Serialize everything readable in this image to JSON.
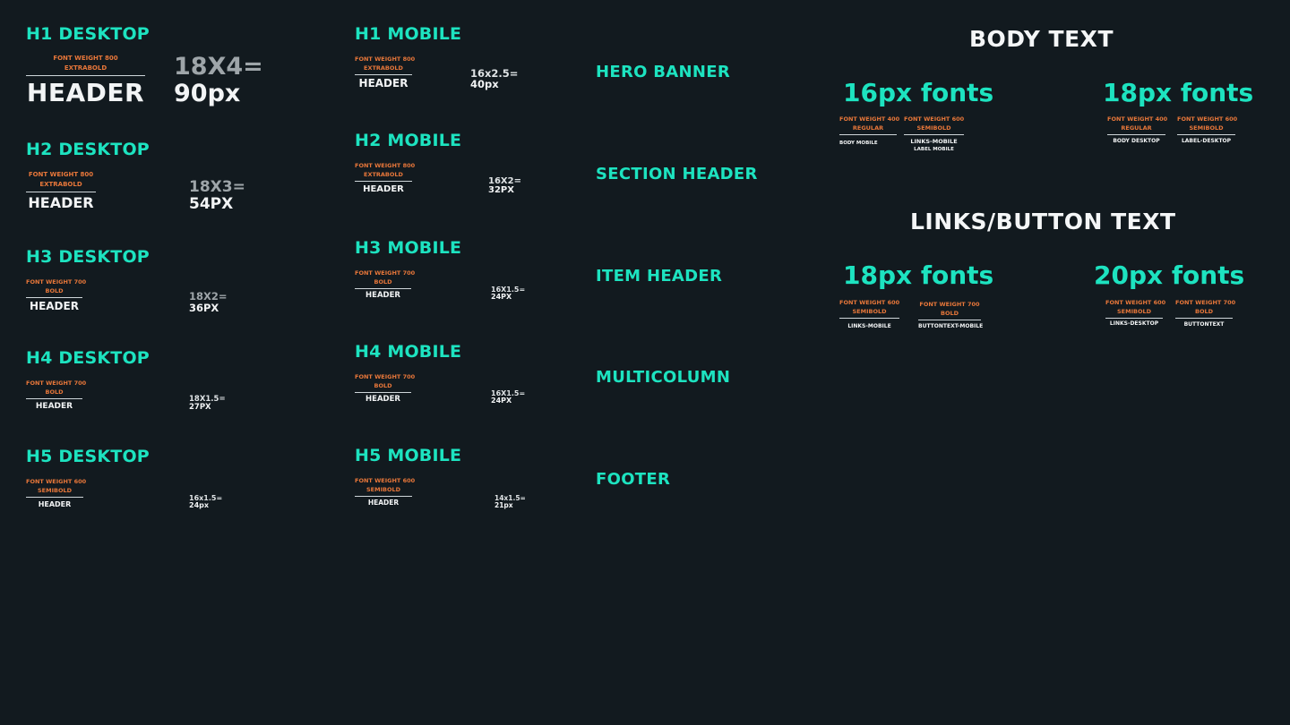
{
  "desktop": [
    {
      "title": "H1 DESKTOP",
      "w1": "FONT WEIGHT 800",
      "w2": "EXTRABOLD",
      "label": "HEADER",
      "c1": "18X4=",
      "c2": "90px"
    },
    {
      "title": "H2 DESKTOP",
      "w1": "FONT WEIGHT 800",
      "w2": "EXTRABOLD",
      "label": "HEADER",
      "c1": "18X3=",
      "c2": "54PX"
    },
    {
      "title": "H3 DESKTOP",
      "w1": "FONT WEIGHT 700",
      "w2": "BOLD",
      "label": "HEADER",
      "c1": "18X2=",
      "c2": "36PX"
    },
    {
      "title": "H4 DESKTOP",
      "w1": "FONT WEIGHT 700",
      "w2": "BOLD",
      "label": "HEADER",
      "c1": "18X1.5=",
      "c2": "27PX"
    },
    {
      "title": "H5 DESKTOP",
      "w1": "FONT WEIGHT 600",
      "w2": "SEMIBOLD",
      "label": "HEADER",
      "c1": "16x1.5=",
      "c2": "24px"
    }
  ],
  "mobile": [
    {
      "title": "H1 MOBILE",
      "w1": "FONT WEIGHT 800",
      "w2": "EXTRABOLD",
      "label": "HEADER",
      "c1": "16x2.5=",
      "c2": "40px"
    },
    {
      "title": "H2 MOBILE",
      "w1": "FONT WEIGHT 800",
      "w2": "EXTRABOLD",
      "label": "HEADER",
      "c1": "16X2=",
      "c2": "32PX"
    },
    {
      "title": "H3 MOBILE",
      "w1": "FONT WEIGHT 700",
      "w2": "BOLD",
      "label": "HEADER",
      "c1": "16X1.5=",
      "c2": "24PX"
    },
    {
      "title": "H4 MOBILE",
      "w1": "FONT WEIGHT 700",
      "w2": "BOLD",
      "label": "HEADER",
      "c1": "16X1.5=",
      "c2": "24PX"
    },
    {
      "title": "H5 MOBILE",
      "w1": "FONT WEIGHT 600",
      "w2": "SEMIBOLD",
      "label": "HEADER",
      "c1": "14x1.5=",
      "c2": "21px"
    }
  ],
  "categories": [
    "HERO BANNER",
    "SECTION HEADER",
    "ITEM HEADER",
    "MULTICOLUMN",
    "FOOTER"
  ],
  "body_text": {
    "heading": "BODY TEXT",
    "f16": "16px fonts",
    "f18": "18px fonts",
    "s16a": {
      "w1": "FONT WEIGHT 400",
      "w2": "REGULAR",
      "label": "BODY MOBILE"
    },
    "s16b": {
      "w1": "FONT WEIGHT 600",
      "w2": "SEMIBOLD",
      "label": "LINKS-MOBILE",
      "label2": "LABEL MOBILE"
    },
    "s18a": {
      "w1": "FONT WEIGHT 400",
      "w2": "REGULAR",
      "label": "BODY DESKTOP"
    },
    "s18b": {
      "w1": "FONT WEIGHT 600",
      "w2": "SEMIBOLD",
      "label": "LABEL-DESKTOP"
    }
  },
  "links_text": {
    "heading": "LINKS/BUTTON TEXT",
    "f18": "18px fonts",
    "f20": "20px fonts",
    "s18a": {
      "w1": "FONT WEIGHT 600",
      "w2": "SEMIBOLD",
      "label": "LINKS-MOBILE"
    },
    "s18b": {
      "w1": "FONT WEIGHT 700",
      "w2": "BOLD",
      "label": "BUTTONTEXT-MOBILE"
    },
    "s20a": {
      "w1": "FONT WEIGHT 600",
      "w2": "SEMIBOLD",
      "label": "LINKS-DESKTOP"
    },
    "s20b": {
      "w1": "FONT WEIGHT 700",
      "w2": "BOLD",
      "label": "BUTTONTEXT"
    }
  }
}
